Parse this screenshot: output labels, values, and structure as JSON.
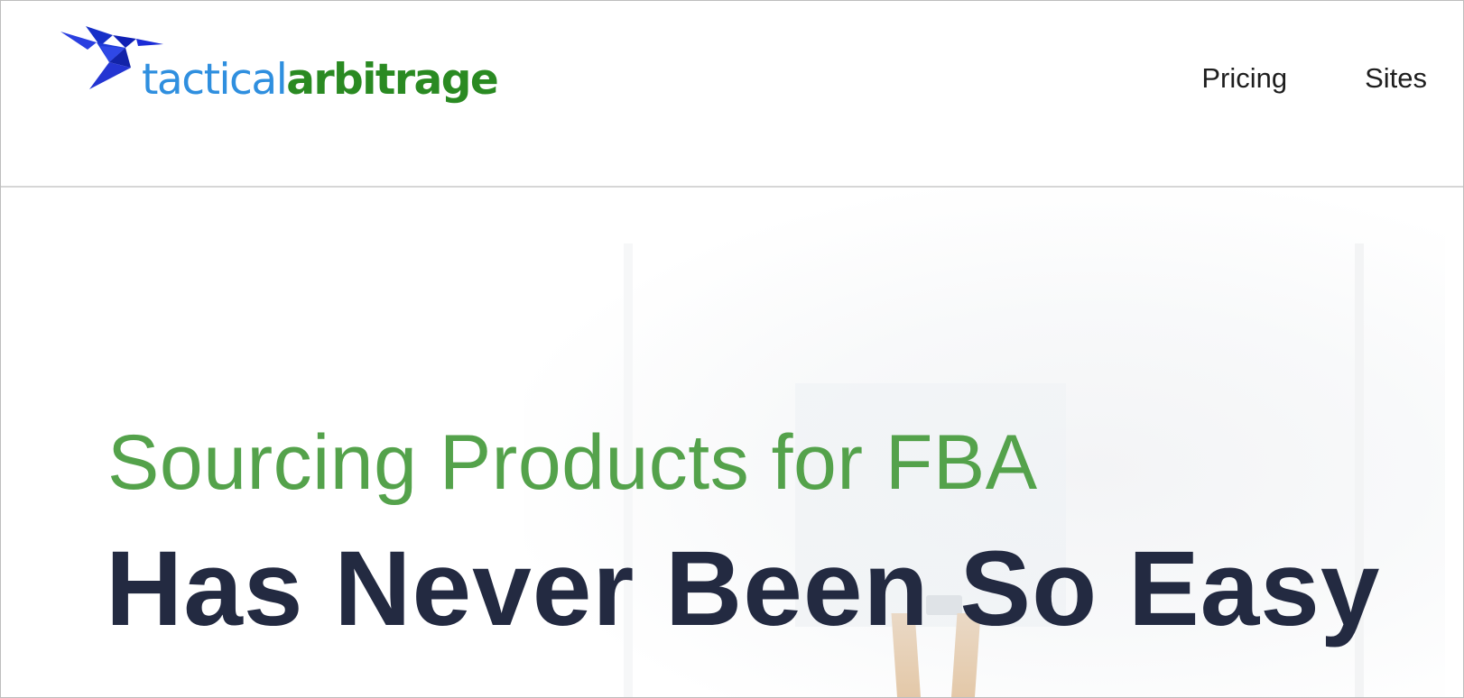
{
  "header": {
    "logo": {
      "icon": "hummingbird-icon",
      "text_part1": "tactical",
      "text_part2": "arbitrage"
    },
    "nav": [
      {
        "label": "Pricing"
      },
      {
        "label": "Sites"
      }
    ]
  },
  "hero": {
    "subtitle": "Sourcing Products for FBA",
    "title": "Has Never Been So Easy"
  },
  "colors": {
    "logo_blue": "#2f8fdf",
    "logo_green": "#2a8a22",
    "bird_blue": "#1a2bd6",
    "subtitle_green": "#54a24b",
    "title_navy": "#232a41",
    "nav_text": "#1e1e1e"
  }
}
